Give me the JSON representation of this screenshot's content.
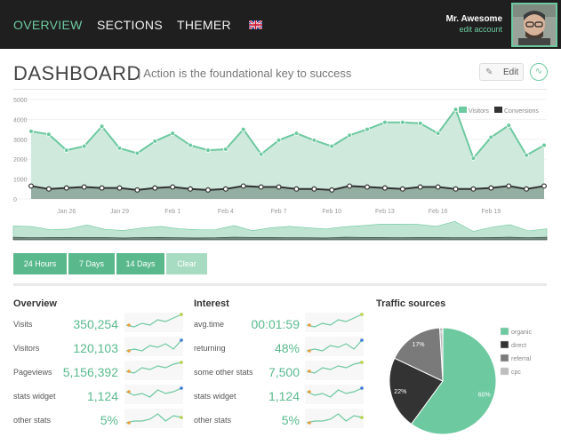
{
  "nav": {
    "items": [
      "OVERVIEW",
      "SECTIONS",
      "THEMER"
    ],
    "active": "OVERVIEW",
    "flag_icon": "uk-flag-icon"
  },
  "user": {
    "name": "Mr. Awesome",
    "edit_label": "edit account"
  },
  "page": {
    "title": "DASHBOARD",
    "subtitle": "| Action is the foundational key to success",
    "edit_label": "Edit"
  },
  "colors": {
    "accent": "#6dc9a0",
    "accent_dark": "#59b98c",
    "dark": "#333333",
    "topbar": "#1f1f1f"
  },
  "chart_data": {
    "type": "area",
    "ylim": [
      0,
      5000
    ],
    "yticks": [
      "5000",
      "4000",
      "3000",
      "2000",
      "1000",
      "0"
    ],
    "xticks": [
      "Jan 26",
      "Jan 29",
      "Feb 1",
      "Feb 4",
      "Feb 7",
      "Feb 10",
      "Feb 13",
      "Feb 16",
      "Feb 19"
    ],
    "legend": [
      "Visitors",
      "Conversions"
    ],
    "legend_position": "top-right",
    "grid": true,
    "series": [
      {
        "name": "Visitors",
        "color": "#6dc9a0",
        "values": [
          3400,
          3250,
          2450,
          2650,
          3650,
          2550,
          2300,
          2900,
          3300,
          2700,
          2450,
          2500,
          3500,
          2250,
          2950,
          3300,
          2950,
          2650,
          3200,
          3500,
          3850,
          3850,
          3800,
          3300,
          4500,
          2050,
          3100,
          3700,
          2200,
          2700
        ]
      },
      {
        "name": "Conversions",
        "color": "#333333",
        "values": [
          650,
          500,
          550,
          600,
          550,
          550,
          450,
          550,
          600,
          500,
          450,
          500,
          650,
          600,
          600,
          500,
          500,
          450,
          650,
          600,
          550,
          500,
          600,
          600,
          500,
          500,
          550,
          650,
          500,
          650
        ]
      }
    ]
  },
  "range_buttons": [
    "24 Hours",
    "7 Days",
    "14 Days",
    "Clear"
  ],
  "overview": {
    "title": "Overview",
    "rows": [
      {
        "label": "Visits",
        "value": "350,254"
      },
      {
        "label": "Visitors",
        "value": "120,103"
      },
      {
        "label": "Pageviews",
        "value": "5,156,392"
      },
      {
        "label": "stats widget",
        "value": "1,124"
      },
      {
        "label": "other stats",
        "value": "5%"
      }
    ]
  },
  "interest": {
    "title": "Interest",
    "rows": [
      {
        "label": "avg.time",
        "value": "00:01:59"
      },
      {
        "label": "returning",
        "value": "48%"
      },
      {
        "label": "some other stats",
        "value": "7,500"
      },
      {
        "label": "stats widget",
        "value": "1,124"
      },
      {
        "label": "other stats",
        "value": "5%"
      }
    ]
  },
  "traffic": {
    "title": "Traffic sources",
    "slices": [
      {
        "name": "organic",
        "value": 60,
        "label": "60%",
        "color": "#6dc9a0"
      },
      {
        "name": "direct",
        "value": 22,
        "label": "22%",
        "color": "#333333"
      },
      {
        "name": "referral",
        "value": 17,
        "label": "17%",
        "color": "#7a7a7a"
      },
      {
        "name": "cpc",
        "value": 1,
        "label": "1%",
        "color": "#bdbdbd"
      }
    ]
  }
}
